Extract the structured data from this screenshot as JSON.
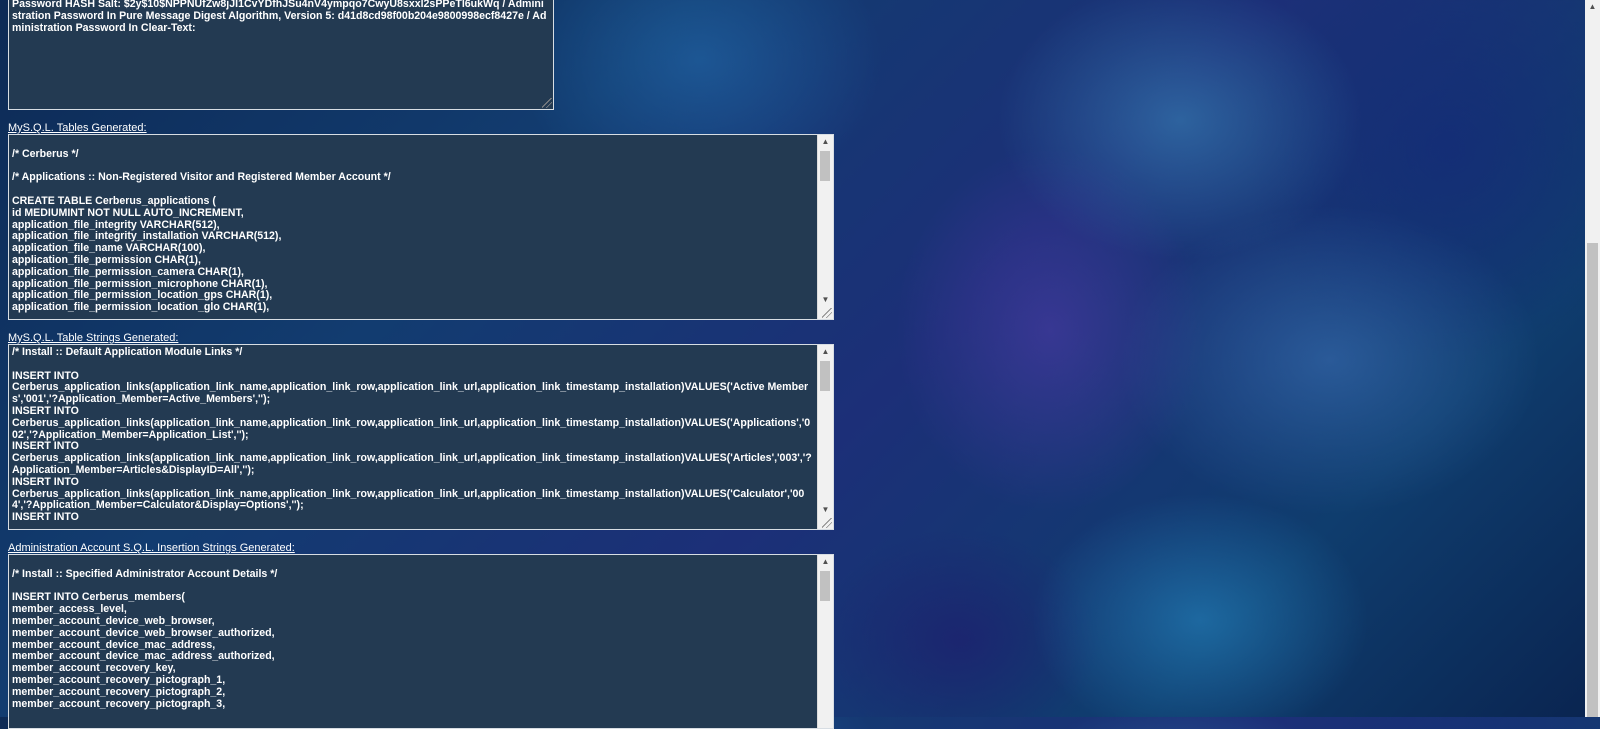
{
  "password_box": {
    "text": "Password HASH Salt: $2y$10$NPPNUfZw8jJI1CvYDfhJSu4nV4ympqo7CwyU8sxxl2sPPeTl6ukWq / Administration Password In Pure Message Digest Algorithm, Version 5: d41d8cd98f00b204e9800998ecf8427e / Administration Password In Clear-Text:"
  },
  "tables": {
    "label": "MyS.Q.L. Tables Generated:",
    "text": "\n/* Cerberus */\n\n/* Applications :: Non-Registered Visitor and Registered Member Account */\n\nCREATE TABLE Cerberus_applications (\nid MEDIUMINT NOT NULL AUTO_INCREMENT,\napplication_file_integrity VARCHAR(512),\napplication_file_integrity_installation VARCHAR(512),\napplication_file_name VARCHAR(100),\napplication_file_permission CHAR(1),\napplication_file_permission_camera CHAR(1),\napplication_file_permission_microphone CHAR(1),\napplication_file_permission_location_gps CHAR(1),\napplication_file_permission_location_glo CHAR(1),"
  },
  "table_strings": {
    "label": "MyS.Q.L. Table Strings Generated:",
    "text": "/* Install :: Default Application Module Links */\n\nINSERT INTO\nCerberus_application_links(application_link_name,application_link_row,application_link_url,application_link_timestamp_installation)VALUES('Active Members','001','?Application_Member=Active_Members','');\nINSERT INTO\nCerberus_application_links(application_link_name,application_link_row,application_link_url,application_link_timestamp_installation)VALUES('Applications','002','?Application_Member=Application_List','');\nINSERT INTO\nCerberus_application_links(application_link_name,application_link_row,application_link_url,application_link_timestamp_installation)VALUES('Articles','003','?Application_Member=Articles&DisplayID=All','');\nINSERT INTO\nCerberus_application_links(application_link_name,application_link_row,application_link_url,application_link_timestamp_installation)VALUES('Calculator','004','?Application_Member=Calculator&Display=Options','');\nINSERT INTO"
  },
  "admin_strings": {
    "label": "Administration Account S.Q.L. Insertion Strings Generated:",
    "text": "\n/* Install :: Specified Administrator Account Details */\n\nINSERT INTO Cerberus_members(\nmember_access_level,\nmember_account_device_web_browser,\nmember_account_device_web_browser_authorized,\nmember_account_device_mac_address,\nmember_account_device_mac_address_authorized,\nmember_account_recovery_key,\nmember_account_recovery_pictograph_1,\nmember_account_recovery_pictograph_2,\nmember_account_recovery_pictograph_3,"
  },
  "icons": {
    "scroll_up": "scroll-up-arrow",
    "scroll_down": "scroll-down-arrow",
    "resize": "resize-grip"
  }
}
